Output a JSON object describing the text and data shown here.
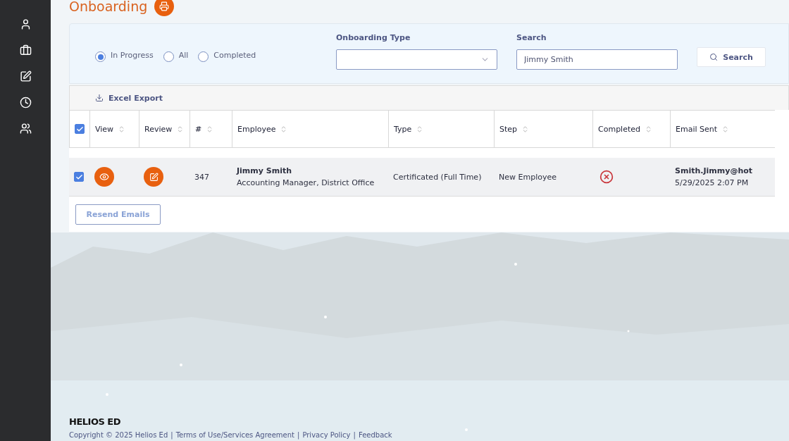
{
  "page_title": "Onboarding",
  "filters": {
    "status_options": [
      {
        "label": "In Progress",
        "selected": true
      },
      {
        "label": "All",
        "selected": false
      },
      {
        "label": "Completed",
        "selected": false
      }
    ],
    "onboarding_type": {
      "label": "Onboarding Type"
    },
    "search": {
      "label": "Search",
      "value": "Jimmy Smith"
    },
    "search_button": "Search"
  },
  "toolbar": {
    "export": "Excel Export"
  },
  "table": {
    "select_all_checked": true,
    "columns": [
      "View",
      "Review",
      "#",
      "Employee",
      "Type",
      "Step",
      "Completed",
      "Email Sent"
    ],
    "rows": [
      {
        "checked": true,
        "number": "347",
        "employee_name": "Jimmy Smith",
        "employee_title": "Accounting Manager, District Office",
        "type": "Certificated (Full Time)",
        "step": "New Employee",
        "completed": false,
        "email": "Smith.Jimmy@hot",
        "email_date": "5/29/2025 2:07 PM"
      }
    ]
  },
  "resend_button": "Resend Emails",
  "footer": {
    "brand": "HELIOS ED",
    "copyright": "Copyright © 2025 Helios Ed",
    "links": [
      {
        "separator": "|",
        "label": "Terms of Use/Services Agreement"
      },
      {
        "separator": "|",
        "label": "Privacy Policy"
      },
      {
        "separator": "|",
        "label": "Feedback"
      }
    ]
  }
}
